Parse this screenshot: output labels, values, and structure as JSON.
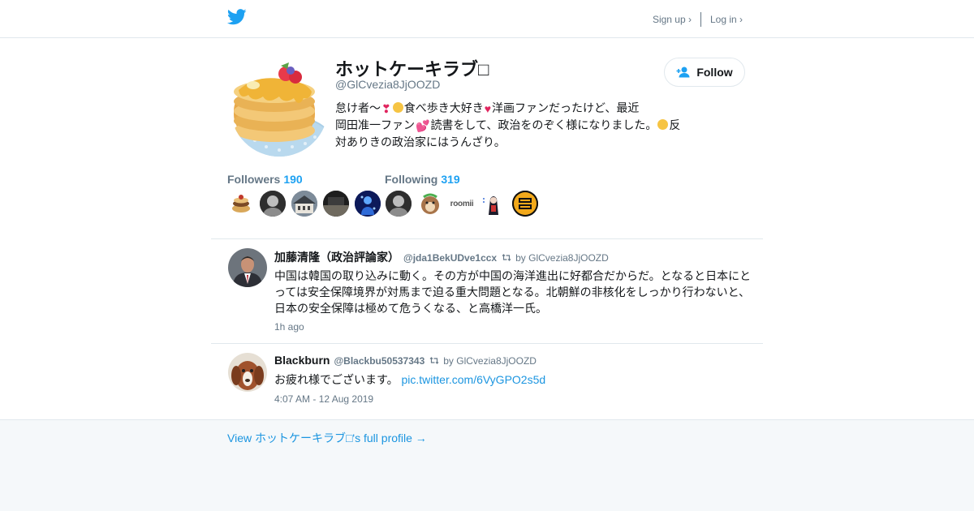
{
  "header": {
    "logo_icon": "twitter-bird-icon",
    "signup_label": "Sign up ›",
    "login_label": "Log in ›",
    "brand_color": "#1da1f2"
  },
  "profile": {
    "name": "ホットケーキラブ□",
    "handle": "@GlCvezia8JjOOZD",
    "follow_label": "Follow",
    "bio": {
      "seg1": "怠け者〜",
      "seg2": "食べ歩き大好き",
      "seg3": "洋画ファンだったけど、最近",
      "seg4": "岡田准一ファン",
      "seg5": "読書をして、政治をのぞく様になりました。",
      "seg6": "反対ありきの政治家にはうんざり。"
    },
    "followers_label": "Followers",
    "followers_count": "190",
    "following_label": "Following",
    "following_count": "319",
    "following_thumb_text": "roomii"
  },
  "tweets": [
    {
      "name": "加藤清隆（政治評論家）",
      "handle": "@jda1BekUDve1ccx",
      "retweeted_by": "by GlCvezia8JjOOZD",
      "text": "中国は韓国の取り込みに動く。その方が中国の海洋進出に好都合だからだ。となると日本にとっては安全保障境界が対馬まで迫る重大問題となる。北朝鮮の非核化をしっかり行わないと、日本の安全保障は極めて危うくなる、と高橋洋一氏。",
      "time": "1h ago"
    },
    {
      "name": "Blackburn",
      "handle": "@Blackbu50537343",
      "retweeted_by": "by GlCvezia8JjOOZD",
      "text": "お疲れ様でございます。",
      "link": "pic.twitter.com/6VyGPO2s5d",
      "time": "4:07 AM - 12 Aug 2019"
    }
  ],
  "footer": {
    "full_profile_label": "View ホットケーキラブ□'s full profile →"
  }
}
